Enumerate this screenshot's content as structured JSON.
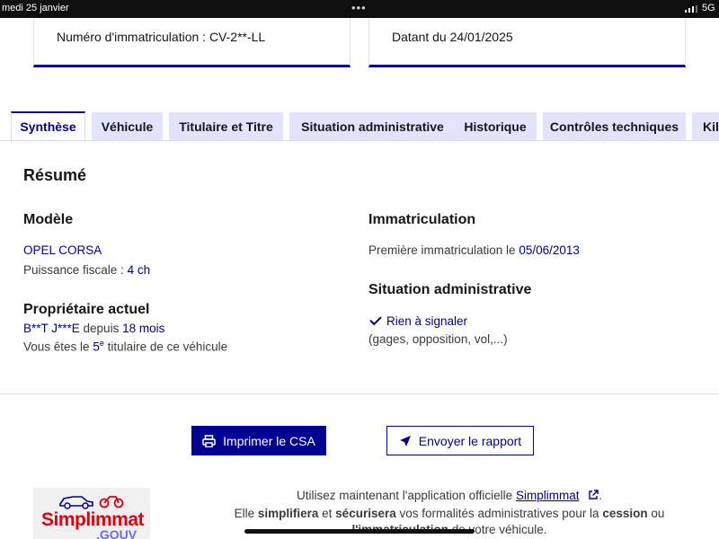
{
  "status_bar": {
    "date": "medi 25 janvier",
    "dots": "•••",
    "network": "5G"
  },
  "cards": {
    "registration": "Numéro d'immatriculation : CV-2**-LL",
    "dated": "Datant du 24/01/2025"
  },
  "tabs": [
    {
      "label": "Synthèse",
      "active": true
    },
    {
      "label": "Véhicule"
    },
    {
      "label": "Titulaire et Titre"
    },
    {
      "label": "Situation administrative"
    },
    {
      "label": "Historique"
    },
    {
      "label": "Contrôles techniques"
    },
    {
      "label": "Kil"
    }
  ],
  "summary": {
    "title": "Résumé",
    "model": {
      "heading": "Modèle",
      "name": "OPEL CORSA",
      "power_label": "Puissance fiscale : ",
      "power_value": "4 ch"
    },
    "owner": {
      "heading": "Propriétaire actuel",
      "name": "B**T J***E",
      "since_label": " depuis ",
      "since_value": "18 mois",
      "holder_prefix": "Vous êtes le ",
      "holder_number": "5",
      "holder_sup": "e",
      "holder_suffix": " titulaire de ce véhicule"
    },
    "registration": {
      "heading": "Immatriculation",
      "first_label": "Première immatriculation le ",
      "first_date": "05/06/2013"
    },
    "admin": {
      "heading": "Situation administrative",
      "status": "Rien à signaler",
      "detail": "(gages, opposition, vol,...)"
    }
  },
  "actions": {
    "print": "Imprimer le CSA",
    "send": "Envoyer le rapport"
  },
  "promo": {
    "logo_text": "Simplimmat",
    "logo_sub": ".GOUV",
    "line1_prefix": "Utilisez maintenant l'application officielle ",
    "line1_link": "Simplimmat",
    "line1_suffix": ".",
    "line2_a": "Elle ",
    "line2_b": "simplifiera",
    "line2_c": " et ",
    "line2_d": "sécurisera",
    "line2_e": " vos formalités administratives pour la ",
    "line2_f": "cession",
    "line2_g": " ou",
    "line3_a": "l'immatriculation",
    "line3_b": " de votre véhicule."
  },
  "colors": {
    "primary": "#000091",
    "tab_bg": "#e3e3fd",
    "text": "#161616",
    "logo_red": "#e1000f"
  }
}
